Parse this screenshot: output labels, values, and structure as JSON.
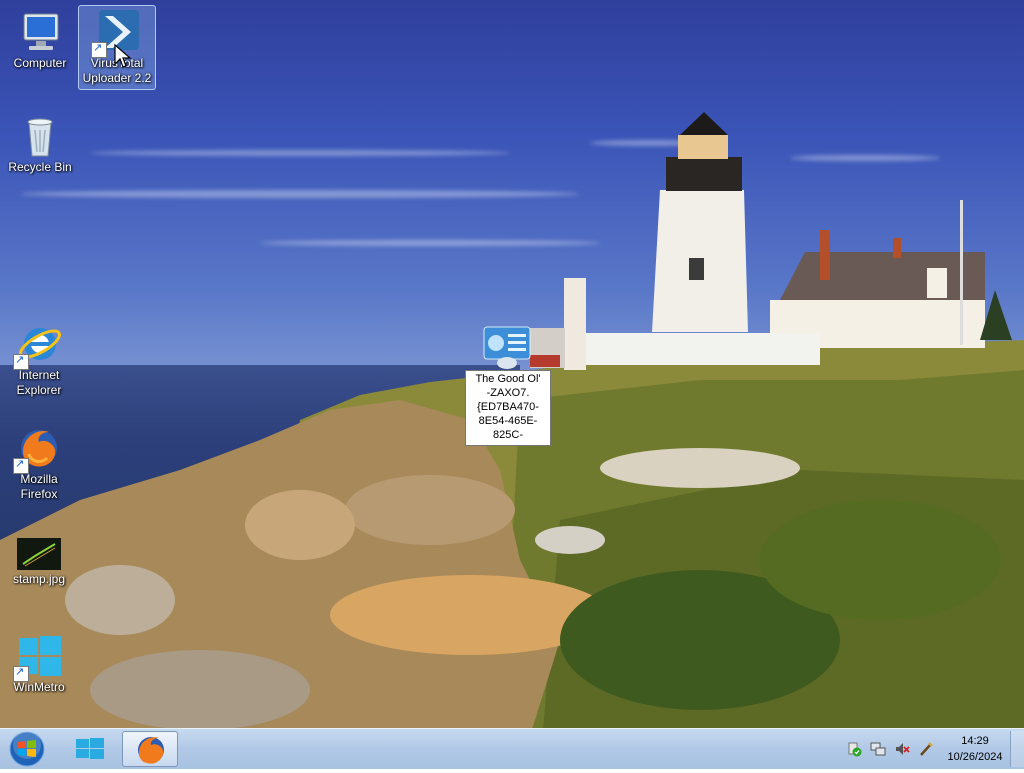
{
  "desktop": {
    "icons": [
      {
        "label": "Computer",
        "icon": "computer-icon",
        "shortcut": false
      },
      {
        "label": "VirusTotal Uploader 2.2",
        "icon": "virustotal-uploader-icon",
        "shortcut": true,
        "selected": true
      },
      {
        "label": "Recycle Bin",
        "icon": "recycle-bin-icon",
        "shortcut": false
      },
      {
        "label": "Internet Explorer",
        "icon": "internet-explorer-icon",
        "shortcut": true
      },
      {
        "label": "Mozilla Firefox",
        "icon": "firefox-icon",
        "shortcut": true
      },
      {
        "label": "stamp.jpg",
        "icon": "image-file-icon",
        "shortcut": false
      },
      {
        "label": "WinMetro",
        "icon": "winmetro-icon",
        "shortcut": true
      }
    ],
    "dragged_item": {
      "icon": "control-panel-shortcut-icon",
      "tooltip_lines": [
        "The Good Ol'",
        "-ZAXO7.",
        "{ED7BA470-",
        "8E54-465E-",
        "825C-"
      ]
    }
  },
  "taskbar": {
    "start_icon": "windows-start-orb-icon",
    "pinned": [
      {
        "name": "metro-start",
        "icon": "windows-metro-icon",
        "active": false
      },
      {
        "name": "firefox",
        "icon": "firefox-icon",
        "active": true
      }
    ],
    "tray": [
      "action-center-icon",
      "network-icon",
      "volume-muted-icon",
      "pen-icon"
    ],
    "clock": {
      "time": "14:29",
      "date": "10/26/2024"
    }
  },
  "colors": {
    "taskbar": "#b1c9e6",
    "sky_top": "#2f3f9c",
    "sea": "#2c3f7a",
    "selection": "#96bef0"
  }
}
